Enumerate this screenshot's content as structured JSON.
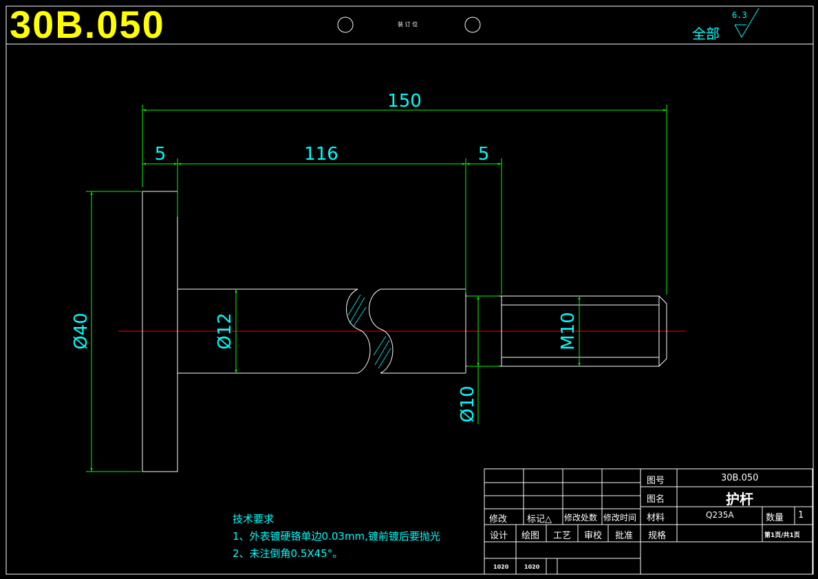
{
  "header": {
    "drawing_code": "30B.050",
    "binding_label": "装 订 位",
    "surface_all_label": "全部",
    "roughness_value": "6.3"
  },
  "dimensions": {
    "total_length": "150",
    "flange_thickness": "5",
    "shaft_length": "116",
    "neck_length": "5",
    "flange_diameter": "Ø40",
    "shaft_diameter": "Ø12",
    "neck_diameter": "Ø10",
    "thread_spec": "M10"
  },
  "tech_requirements": {
    "title": "技术要求",
    "items": [
      "1、外表镀硬铬单边0.03mm,镀前镀后要抛光",
      "2、未注倒角0.5X45°。"
    ]
  },
  "title_block": {
    "drawing_no_label": "图号",
    "drawing_no": "30B.050",
    "name_label": "图名",
    "name": "护杆",
    "material_label": "材料",
    "material": "Q235A",
    "quantity_label": "数量",
    "quantity": "1",
    "spec_label": "规格",
    "page_info": "第1页/共1页",
    "revision_headers": [
      "修改",
      "标记△",
      "修改处数",
      "修改时间"
    ],
    "role_headers": [
      "设计",
      "绘图",
      "工艺",
      "审校",
      "批准"
    ],
    "role_values": [
      "1020",
      "1020"
    ]
  },
  "colors": {
    "outline": "#ffffff",
    "dimension_line": "#00ff00",
    "dimension_text": "#00ffff",
    "centerline": "#ff0000",
    "title_text": "#ffff00",
    "background": "#000000"
  }
}
